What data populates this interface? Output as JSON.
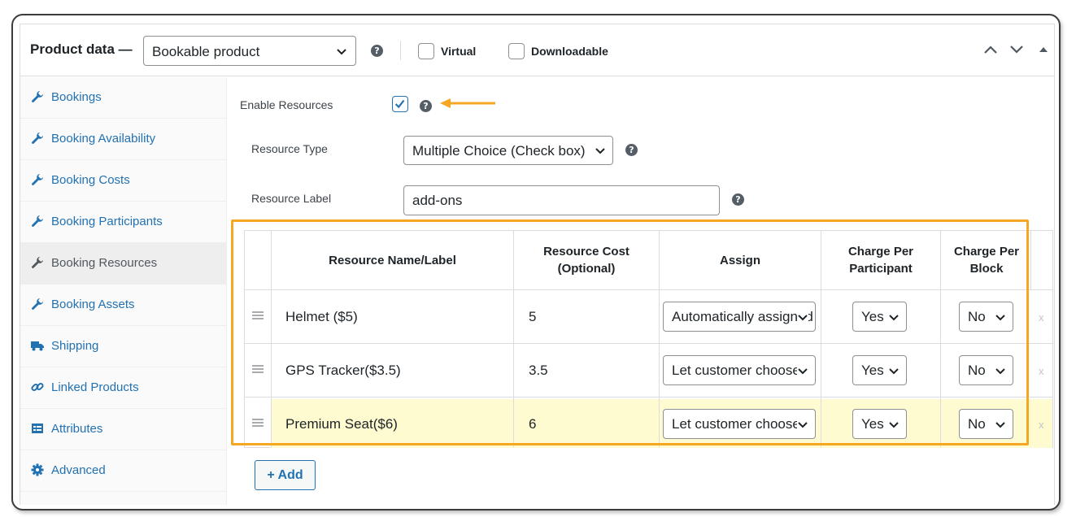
{
  "header": {
    "title": "Product data —",
    "product_type": "Bookable product",
    "virtual_label": "Virtual",
    "downloadable_label": "Downloadable"
  },
  "sidebar": {
    "items": [
      {
        "label": "Bookings",
        "icon": "wrench-icon"
      },
      {
        "label": "Booking Availability",
        "icon": "wrench-icon"
      },
      {
        "label": "Booking Costs",
        "icon": "wrench-icon"
      },
      {
        "label": "Booking Participants",
        "icon": "wrench-icon"
      },
      {
        "label": "Booking Resources",
        "icon": "wrench-icon",
        "active": true
      },
      {
        "label": "Booking Assets",
        "icon": "wrench-icon"
      },
      {
        "label": "Shipping",
        "icon": "truck-icon"
      },
      {
        "label": "Linked Products",
        "icon": "link-icon"
      },
      {
        "label": "Attributes",
        "icon": "list-icon"
      },
      {
        "label": "Advanced",
        "icon": "gear-icon"
      }
    ]
  },
  "form": {
    "enable_resources_label": "Enable Resources",
    "enable_resources_checked": true,
    "resource_type_label": "Resource Type",
    "resource_type_value": "Multiple Choice (Check box)",
    "resource_label_label": "Resource Label",
    "resource_label_value": "add-ons"
  },
  "table": {
    "headers": {
      "name": "Resource Name/Label",
      "cost_line1": "Resource Cost",
      "cost_line2": "(Optional)",
      "assign": "Assign",
      "cpp_line1": "Charge Per",
      "cpp_line2": "Participant",
      "cpb_line1": "Charge Per",
      "cpb_line2": "Block"
    },
    "rows": [
      {
        "name": "Helmet ($5)",
        "cost": "5",
        "assign": "Automatically assigned",
        "per_participant": "Yes",
        "per_block": "No",
        "remove": "x"
      },
      {
        "name": "GPS Tracker($3.5)",
        "cost": "3.5",
        "assign": "Let customer choose",
        "per_participant": "Yes",
        "per_block": "No",
        "remove": "x"
      },
      {
        "name": "Premium Seat($6)",
        "cost": "6",
        "assign": "Let customer choose",
        "per_participant": "Yes",
        "per_block": "No",
        "remove": "x"
      }
    ]
  },
  "add_button": "+ Add",
  "colors": {
    "accent_blue": "#2271b1",
    "highlight_orange": "#f5a623",
    "highlight_row": "#fdfbcf"
  }
}
